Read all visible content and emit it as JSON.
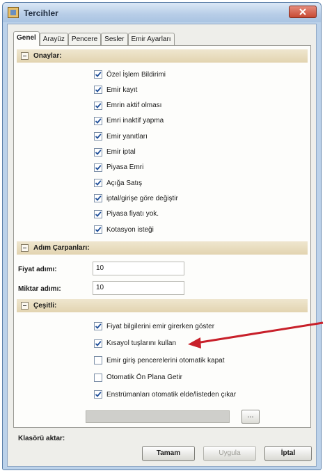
{
  "window": {
    "title": "Tercihler"
  },
  "tabs": [
    {
      "label": "Genel"
    },
    {
      "label": "Arayüz"
    },
    {
      "label": "Pencere"
    },
    {
      "label": "Sesler"
    },
    {
      "label": "Emir Ayarları"
    }
  ],
  "onaylar": {
    "header": "Onaylar:",
    "items": [
      {
        "label": "Özel İşlem Bildirimi",
        "checked": true
      },
      {
        "label": "Emir kayıt",
        "checked": true
      },
      {
        "label": "Emrin aktif olması",
        "checked": true
      },
      {
        "label": "Emri inaktif yapma",
        "checked": true
      },
      {
        "label": "Emir yanıtları",
        "checked": true
      },
      {
        "label": "Emir iptal",
        "checked": true
      },
      {
        "label": "Piyasa Emri",
        "checked": true
      },
      {
        "label": "Açığa Satış",
        "checked": true
      },
      {
        "label": "iptal/girişe göre değiştir",
        "checked": true
      },
      {
        "label": "Piyasa fiyatı yok.",
        "checked": true
      },
      {
        "label": "Kotasyon isteği",
        "checked": true
      }
    ]
  },
  "adim": {
    "header": "Adım Çarpanları:",
    "fiyat_label": "Fiyat adımı:",
    "fiyat_value": "10",
    "miktar_label": "Miktar adımı:",
    "miktar_value": "10"
  },
  "cesitli": {
    "header": "Çeşitli:",
    "items": [
      {
        "label": "Fiyat bilgilerini emir girerken göster",
        "checked": true
      },
      {
        "label": "Kısayol tuşlarını kullan",
        "checked": true
      },
      {
        "label": "Emir giriş pencerelerini otomatik kapat",
        "checked": false
      },
      {
        "label": "Otomatik Ön Plana Getir",
        "checked": false
      },
      {
        "label": "Enstrümanları otomatik elde/listeden çıkar",
        "checked": true
      }
    ],
    "folder_label": "Klasörü aktar:",
    "browse_label": "..."
  },
  "buttons": {
    "ok": "Tamam",
    "apply": "Uygula",
    "cancel": "İptal"
  },
  "colors": {
    "annotation_arrow": "#c8202a",
    "section_header": "#e6d9b8"
  }
}
